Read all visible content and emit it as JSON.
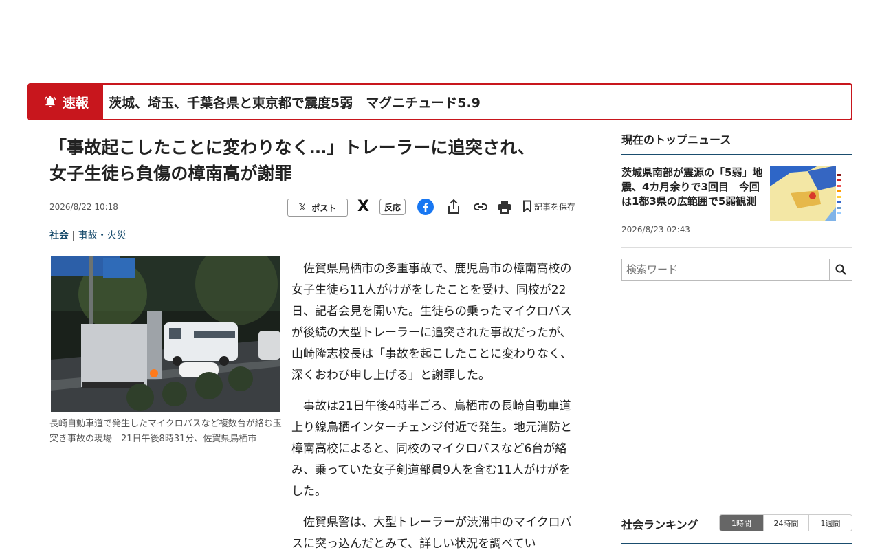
{
  "breaking": {
    "label": "速報",
    "text": "茨城、埼玉、千葉各県と東京都で震度5弱　マグニチュード5.9"
  },
  "article": {
    "headline_line1": "「事故起こしたことに変わりなく…」トレーラーに追突され、",
    "headline_line2": "女子生徒ら負傷の樟南高が謝罪",
    "date": "2026/8/22 10:18",
    "post_label": "ポスト",
    "x_label": "X",
    "reaction_label": "反応",
    "save_label": "記事を保存",
    "category_main": "社会",
    "category_sep": "|",
    "category_sub": "事故・火災",
    "caption": "長崎自動車道で発生したマイクロバスなど複数台が絡む玉突き事故の現場＝21日午後8時31分、佐賀県鳥栖市",
    "paragraphs": [
      "佐賀県鳥栖市の多重事故で、鹿児島市の樟南高校の女子生徒ら11人がけがをしたことを受け、同校が22日、記者会見を開いた。生徒らの乗ったマイクロバスが後続の大型トレーラーに追突された事故だったが、山崎隆志校長は「事故を起こしたことに変わりなく、深くおわび申し上げる」と謝罪した。",
      "事故は21日午後4時半ごろ、鳥栖市の長崎自動車道上り線鳥栖インターチェンジ付近で発生。地元消防と樟南高校によると、同校のマイクロバスなど6台が絡み、乗っていた女子剣道部員9人を含む11人がけがをした。",
      "佐賀県警は、大型トレーラーが渋滞中のマイクロバスに突っ込んだとみて、詳しい状況を調べてい"
    ]
  },
  "sidebar": {
    "top_news_heading": "現在のトップニュース",
    "top_news_title": "茨城県南部が震源の「5弱」地震、4カ月余りで3回目　今回は1都3県の広範囲で5弱観測",
    "top_news_date": "2026/8/23 02:43",
    "search_placeholder": "検索ワード",
    "ranking_heading": "社会ランキング",
    "ranking_tabs": [
      "1時間",
      "24時間",
      "1週間"
    ]
  },
  "colors": {
    "breaking_red": "#c8161d",
    "accent_navy": "#1a4d6e",
    "facebook_blue": "#1877f2"
  }
}
